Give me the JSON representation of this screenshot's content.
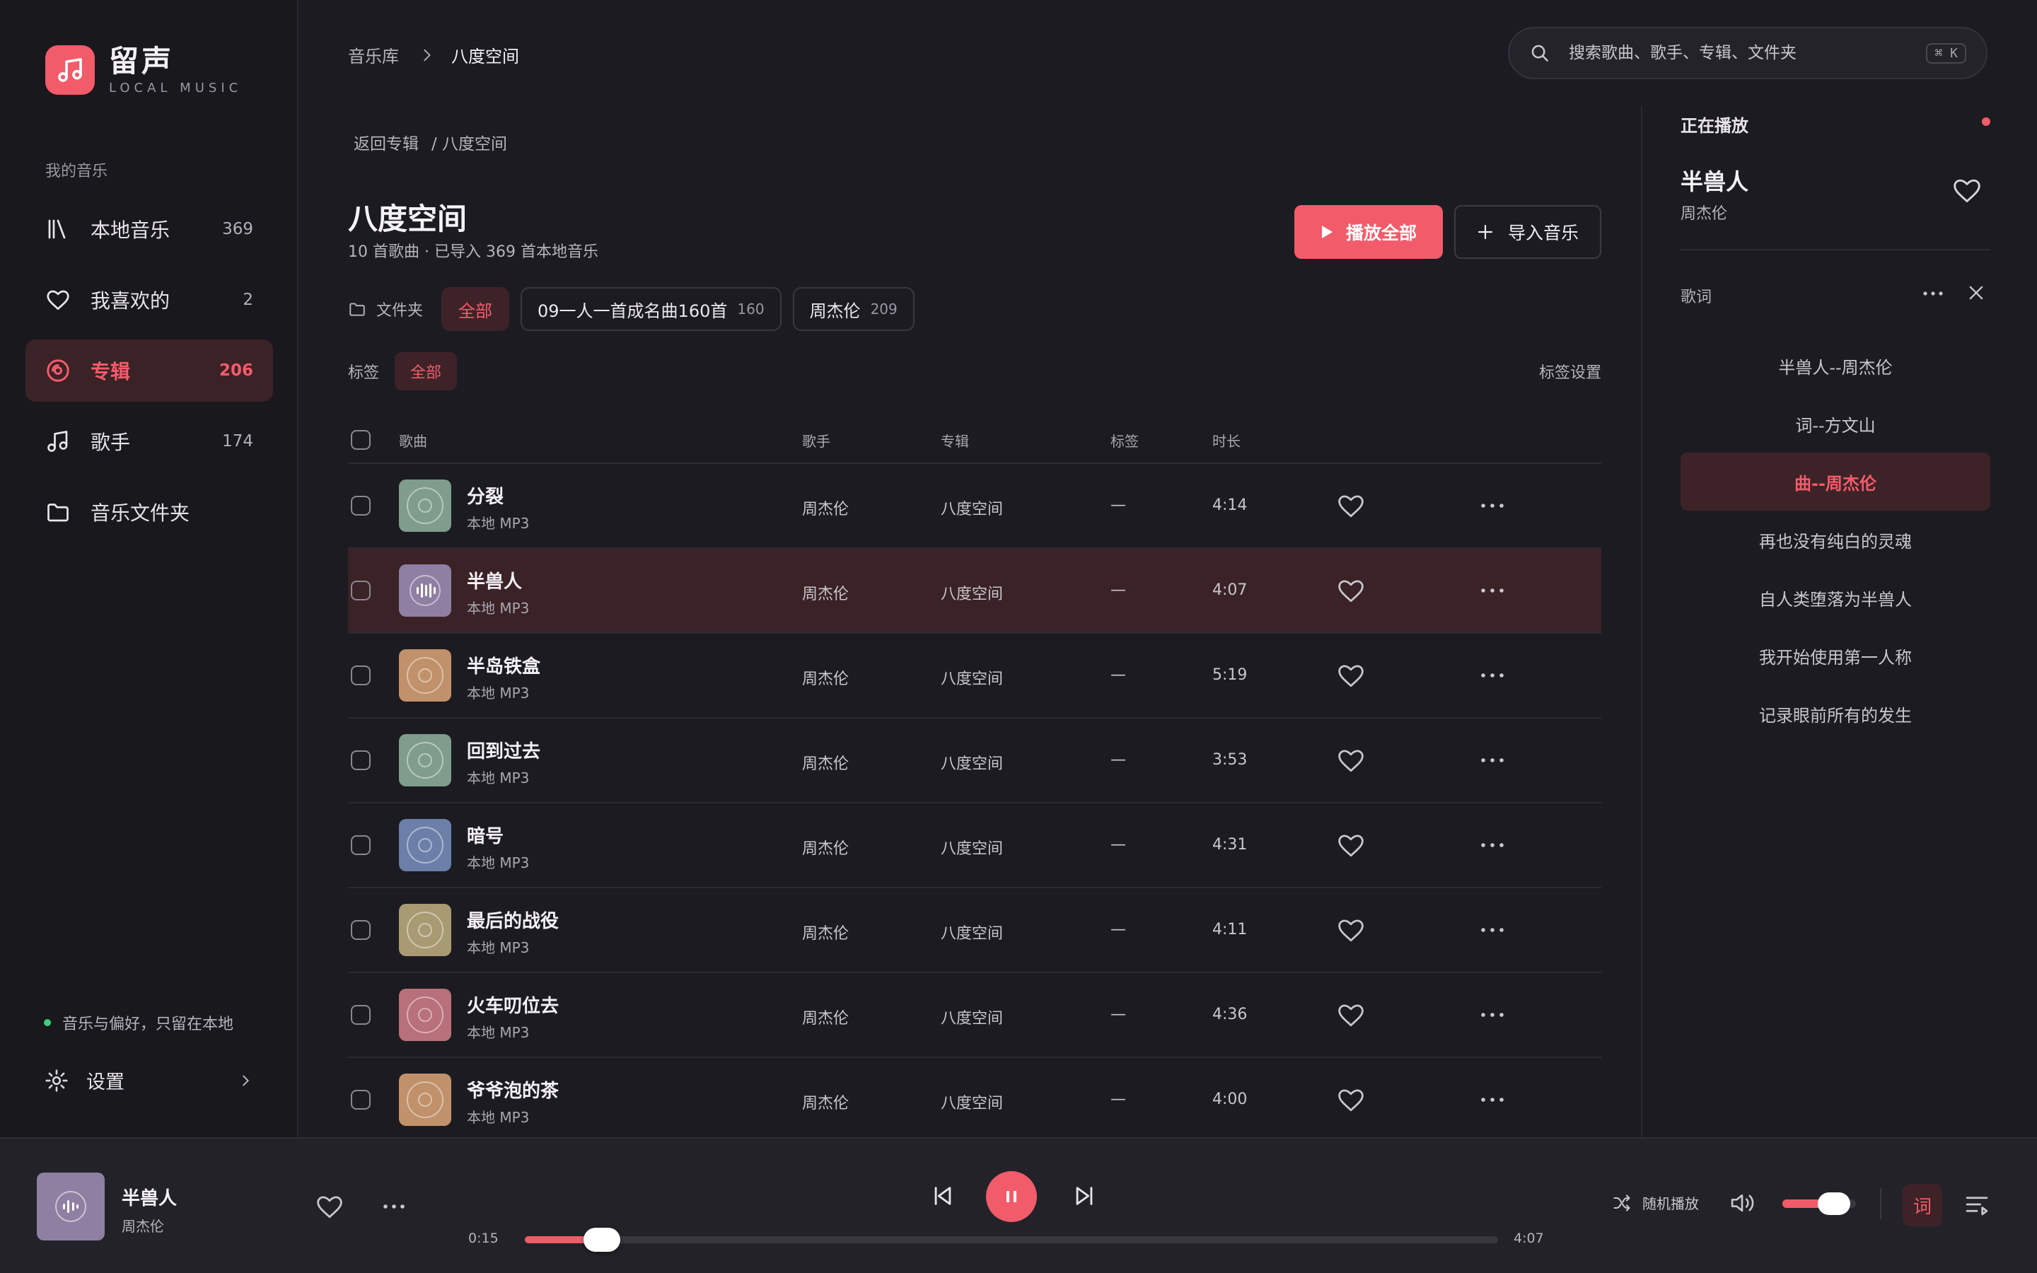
{
  "colors": {
    "accent": "#f25b6a",
    "background": "#1c1b21",
    "sidebar": "#19181d",
    "active_bg": "#3a2226",
    "privacy_dot": "#3ecf7b"
  },
  "app": {
    "name": "留声",
    "subtitle": "LOCAL MUSIC"
  },
  "sidebar": {
    "section_label": "我的音乐",
    "items": [
      {
        "label": "本地音乐",
        "count": "369",
        "icon": "library-icon",
        "active": false
      },
      {
        "label": "我喜欢的",
        "count": "2",
        "icon": "heart-icon",
        "active": false
      },
      {
        "label": "专辑",
        "count": "206",
        "icon": "disc-icon",
        "active": true
      },
      {
        "label": "歌手",
        "count": "174",
        "icon": "music-note-icon",
        "active": false
      },
      {
        "label": "音乐文件夹",
        "count": "",
        "icon": "folder-icon",
        "active": false
      }
    ],
    "privacy_text": "音乐与偏好，只留在本地",
    "settings_label": "设置"
  },
  "topbar": {
    "breadcrumb_root": "音乐库",
    "breadcrumb_current": "八度空间",
    "search_placeholder": "搜索歌曲、歌手、专辑、文件夹",
    "search_shortcut": "⌘ K"
  },
  "album": {
    "back_label": "返回专辑",
    "crumb": "/ 八度空间",
    "title": "八度空间",
    "meta": "10 首歌曲 · 已导入 369 首本地音乐",
    "play_all": "播放全部",
    "import": "导入音乐"
  },
  "filters": {
    "folder_label": "文件夹",
    "chips": [
      {
        "label": "全部",
        "count": "",
        "active": true
      },
      {
        "label": "09一人一首成名曲160首",
        "count": "160",
        "active": false
      },
      {
        "label": "周杰伦",
        "count": "209",
        "active": false
      }
    ],
    "tag_label": "标签",
    "tag_all": "全部",
    "tag_settings": "标签设置"
  },
  "table": {
    "headers": {
      "song": "歌曲",
      "artist": "歌手",
      "album": "专辑",
      "tag": "标签",
      "duration": "时长"
    },
    "rows": [
      {
        "title": "分裂",
        "source": "本地 MP3",
        "artist": "周杰伦",
        "album": "八度空间",
        "tag": "—",
        "duration": "4:14",
        "cover": "#7f9c8c",
        "playing": false
      },
      {
        "title": "半兽人",
        "source": "本地 MP3",
        "artist": "周杰伦",
        "album": "八度空间",
        "tag": "—",
        "duration": "4:07",
        "cover": "#8f7fa3",
        "playing": true
      },
      {
        "title": "半岛铁盒",
        "source": "本地 MP3",
        "artist": "周杰伦",
        "album": "八度空间",
        "tag": "—",
        "duration": "5:19",
        "cover": "#c0916a",
        "playing": false
      },
      {
        "title": "回到过去",
        "source": "本地 MP3",
        "artist": "周杰伦",
        "album": "八度空间",
        "tag": "—",
        "duration": "3:53",
        "cover": "#7f9c8c",
        "playing": false
      },
      {
        "title": "暗号",
        "source": "本地 MP3",
        "artist": "周杰伦",
        "album": "八度空间",
        "tag": "—",
        "duration": "4:31",
        "cover": "#6c7fa8",
        "playing": false
      },
      {
        "title": "最后的战役",
        "source": "本地 MP3",
        "artist": "周杰伦",
        "album": "八度空间",
        "tag": "—",
        "duration": "4:11",
        "cover": "#a89a72",
        "playing": false
      },
      {
        "title": "火车叨位去",
        "source": "本地 MP3",
        "artist": "周杰伦",
        "album": "八度空间",
        "tag": "—",
        "duration": "4:36",
        "cover": "#b8707a",
        "playing": false
      },
      {
        "title": "爷爷泡的茶",
        "source": "本地 MP3",
        "artist": "周杰伦",
        "album": "八度空间",
        "tag": "—",
        "duration": "4:00",
        "cover": "#c0916a",
        "playing": false
      }
    ]
  },
  "now_playing_panel": {
    "heading": "正在播放",
    "title": "半兽人",
    "artist": "周杰伦",
    "lyrics_label": "歌词",
    "lyrics": [
      "半兽人--周杰伦",
      "词--方文山",
      "曲--周杰伦",
      "再也没有纯白的灵魂",
      "自人类堕落为半兽人",
      "我开始使用第一人称",
      "记录眼前所有的发生"
    ],
    "current_lyric_index": 2
  },
  "player": {
    "title": "半兽人",
    "artist": "周杰伦",
    "current_time": "0:15",
    "total_time": "4:07",
    "progress": 0.06,
    "shuffle_label": "随机播放",
    "volume": 0.7,
    "lyrics_button": "词"
  }
}
